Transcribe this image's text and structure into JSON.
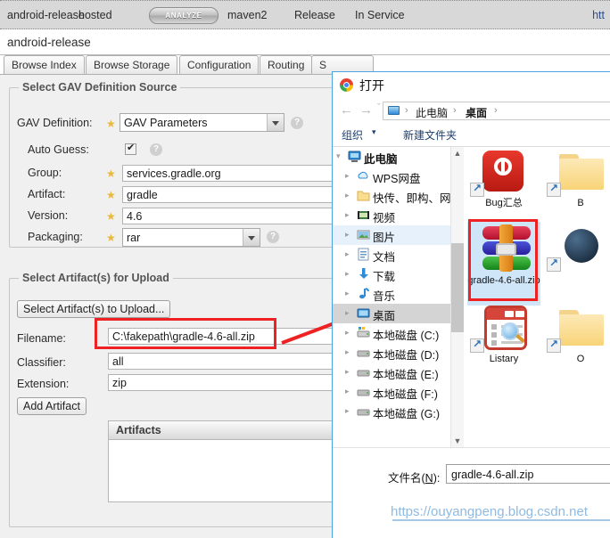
{
  "repo_bar": {
    "name": "android-release",
    "type": "hosted",
    "analyze_label": "ANALYZE",
    "format": "maven2",
    "policy": "Release",
    "status": "In Service",
    "url": "htt"
  },
  "page": {
    "title": "android-release",
    "tabs": [
      {
        "label": "Browse Index"
      },
      {
        "label": "Browse Storage"
      },
      {
        "label": "Configuration"
      },
      {
        "label": "Routing"
      },
      {
        "label": "S"
      }
    ]
  },
  "gav": {
    "legend": "Select GAV Definition Source",
    "definition_label": "GAV Definition:",
    "definition_value": "GAV Parameters",
    "auto_guess_label": "Auto Guess:",
    "auto_guess_checked": true,
    "group_label": "Group:",
    "group_value": "services.gradle.org",
    "artifact_label": "Artifact:",
    "artifact_value": "gradle",
    "version_label": "Version:",
    "version_value": "4.6",
    "packaging_label": "Packaging:",
    "packaging_value": "rar",
    "required_star": "★",
    "help_glyph": "?"
  },
  "upload": {
    "legend": "Select Artifact(s) for Upload",
    "select_button": "Select Artifact(s) to Upload...",
    "filename_label": "Filename:",
    "filename_value": "C:\\fakepath\\gradle-4.6-all.zip",
    "classifier_label": "Classifier:",
    "classifier_value": "all",
    "extension_label": "Extension:",
    "extension_value": "zip",
    "add_button": "Add Artifact",
    "artifacts_header": "Artifacts",
    "artifacts_rows": []
  },
  "dialog": {
    "title": "打开",
    "nav": {
      "back": "←",
      "forward": "→",
      "history": "ˇ",
      "up": "↑",
      "crumbs": [
        "此电脑",
        "桌面"
      ],
      "separator": "›"
    },
    "commands": {
      "organize": "组织",
      "organize_caret": "▾",
      "new_folder": "新建文件夹"
    },
    "tree": [
      {
        "label": "此电脑",
        "icon": "computer-icon",
        "depth": 0,
        "expanded": true,
        "state": "none"
      },
      {
        "label": "WPS网盘",
        "icon": "cloud-icon",
        "depth": 1,
        "expanded": false,
        "state": "none"
      },
      {
        "label": "快传、即构、网!",
        "icon": "folder-icon",
        "depth": 1,
        "expanded": false,
        "state": "none"
      },
      {
        "label": "视频",
        "icon": "video-icon",
        "depth": 1,
        "expanded": false,
        "state": "none"
      },
      {
        "label": "图片",
        "icon": "pictures-icon",
        "depth": 1,
        "expanded": false,
        "state": "hover"
      },
      {
        "label": "文档",
        "icon": "documents-icon",
        "depth": 1,
        "expanded": false,
        "state": "none"
      },
      {
        "label": "下载",
        "icon": "downloads-icon",
        "depth": 1,
        "expanded": false,
        "state": "none"
      },
      {
        "label": "音乐",
        "icon": "music-icon",
        "depth": 1,
        "expanded": false,
        "state": "none"
      },
      {
        "label": "桌面",
        "icon": "desktop-icon",
        "depth": 1,
        "expanded": false,
        "state": "selected"
      },
      {
        "label": "本地磁盘 (C:)",
        "icon": "system-drive-icon",
        "depth": 1,
        "expanded": false,
        "state": "none"
      },
      {
        "label": "本地磁盘 (D:)",
        "icon": "drive-icon",
        "depth": 1,
        "expanded": false,
        "state": "none"
      },
      {
        "label": "本地磁盘 (E:)",
        "icon": "drive-icon",
        "depth": 1,
        "expanded": false,
        "state": "none"
      },
      {
        "label": "本地磁盘 (F:)",
        "icon": "drive-icon",
        "depth": 1,
        "expanded": false,
        "state": "none"
      },
      {
        "label": "本地磁盘 (G:)",
        "icon": "drive-icon",
        "depth": 1,
        "expanded": false,
        "state": "none"
      }
    ],
    "files": [
      {
        "name": "Bug汇总",
        "icon": "acrobat-icon",
        "shortcut": true,
        "selected": false
      },
      {
        "name": "B",
        "icon": "folder-icon",
        "shortcut": true,
        "selected": false
      },
      {
        "name": "gradle-4.6-all.zip",
        "icon": "winrar-zip-icon",
        "shortcut": false,
        "selected": true
      },
      {
        "name": "",
        "icon": "globe-icon",
        "shortcut": true,
        "selected": false
      },
      {
        "name": "Listary",
        "icon": "listary-icon",
        "shortcut": true,
        "selected": false
      },
      {
        "name": "O",
        "icon": "folder-icon",
        "shortcut": true,
        "selected": false
      }
    ],
    "filename_label_prefix": "文件名(",
    "filename_label_key": "N",
    "filename_label_suffix": "):",
    "filename_value": "gradle-4.6-all.zip"
  },
  "watermark": {
    "text": "https://ouyangpeng.blog.csdn.net"
  },
  "colors": {
    "accent_red": "#ee2222",
    "dialog_border": "#4aa3e0",
    "link_blue": "#2d4d8e"
  }
}
